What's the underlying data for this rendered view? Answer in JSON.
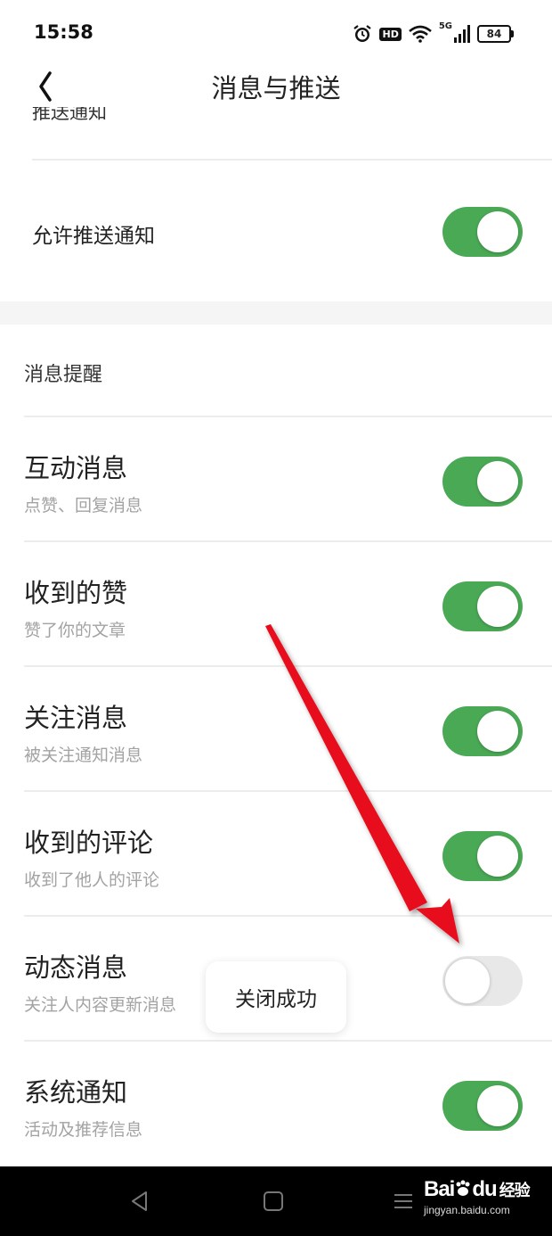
{
  "status_bar": {
    "time": "15:58",
    "hd_badge": "HD",
    "network": "5G",
    "battery_level": "84"
  },
  "header": {
    "title": "消息与推送",
    "back_icon": "chevron-left-icon"
  },
  "push_section": {
    "partial_label": "推送通知",
    "allow_label": "允许推送通知",
    "allow_enabled": true
  },
  "reminders": {
    "title": "消息提醒",
    "items": [
      {
        "title": "互动消息",
        "subtitle": "点赞、回复消息",
        "enabled": true
      },
      {
        "title": "收到的赞",
        "subtitle": "赞了你的文章",
        "enabled": true
      },
      {
        "title": "关注消息",
        "subtitle": "被关注通知消息",
        "enabled": true
      },
      {
        "title": "收到的评论",
        "subtitle": "收到了他人的评论",
        "enabled": true
      },
      {
        "title": "动态消息",
        "subtitle": "关注人内容更新消息",
        "enabled": false
      },
      {
        "title": "系统通知",
        "subtitle": "活动及推荐信息",
        "enabled": true
      }
    ]
  },
  "toast": {
    "message": "关闭成功"
  },
  "watermark": {
    "logo_text": "Bai",
    "logo_suffix": "du",
    "logo_cn": "经验",
    "url": "jingyan.baidu.com"
  },
  "colors": {
    "toggle_on": "#4aa955",
    "toggle_off": "#e8e8e8",
    "annotation_arrow": "#e8101a"
  }
}
